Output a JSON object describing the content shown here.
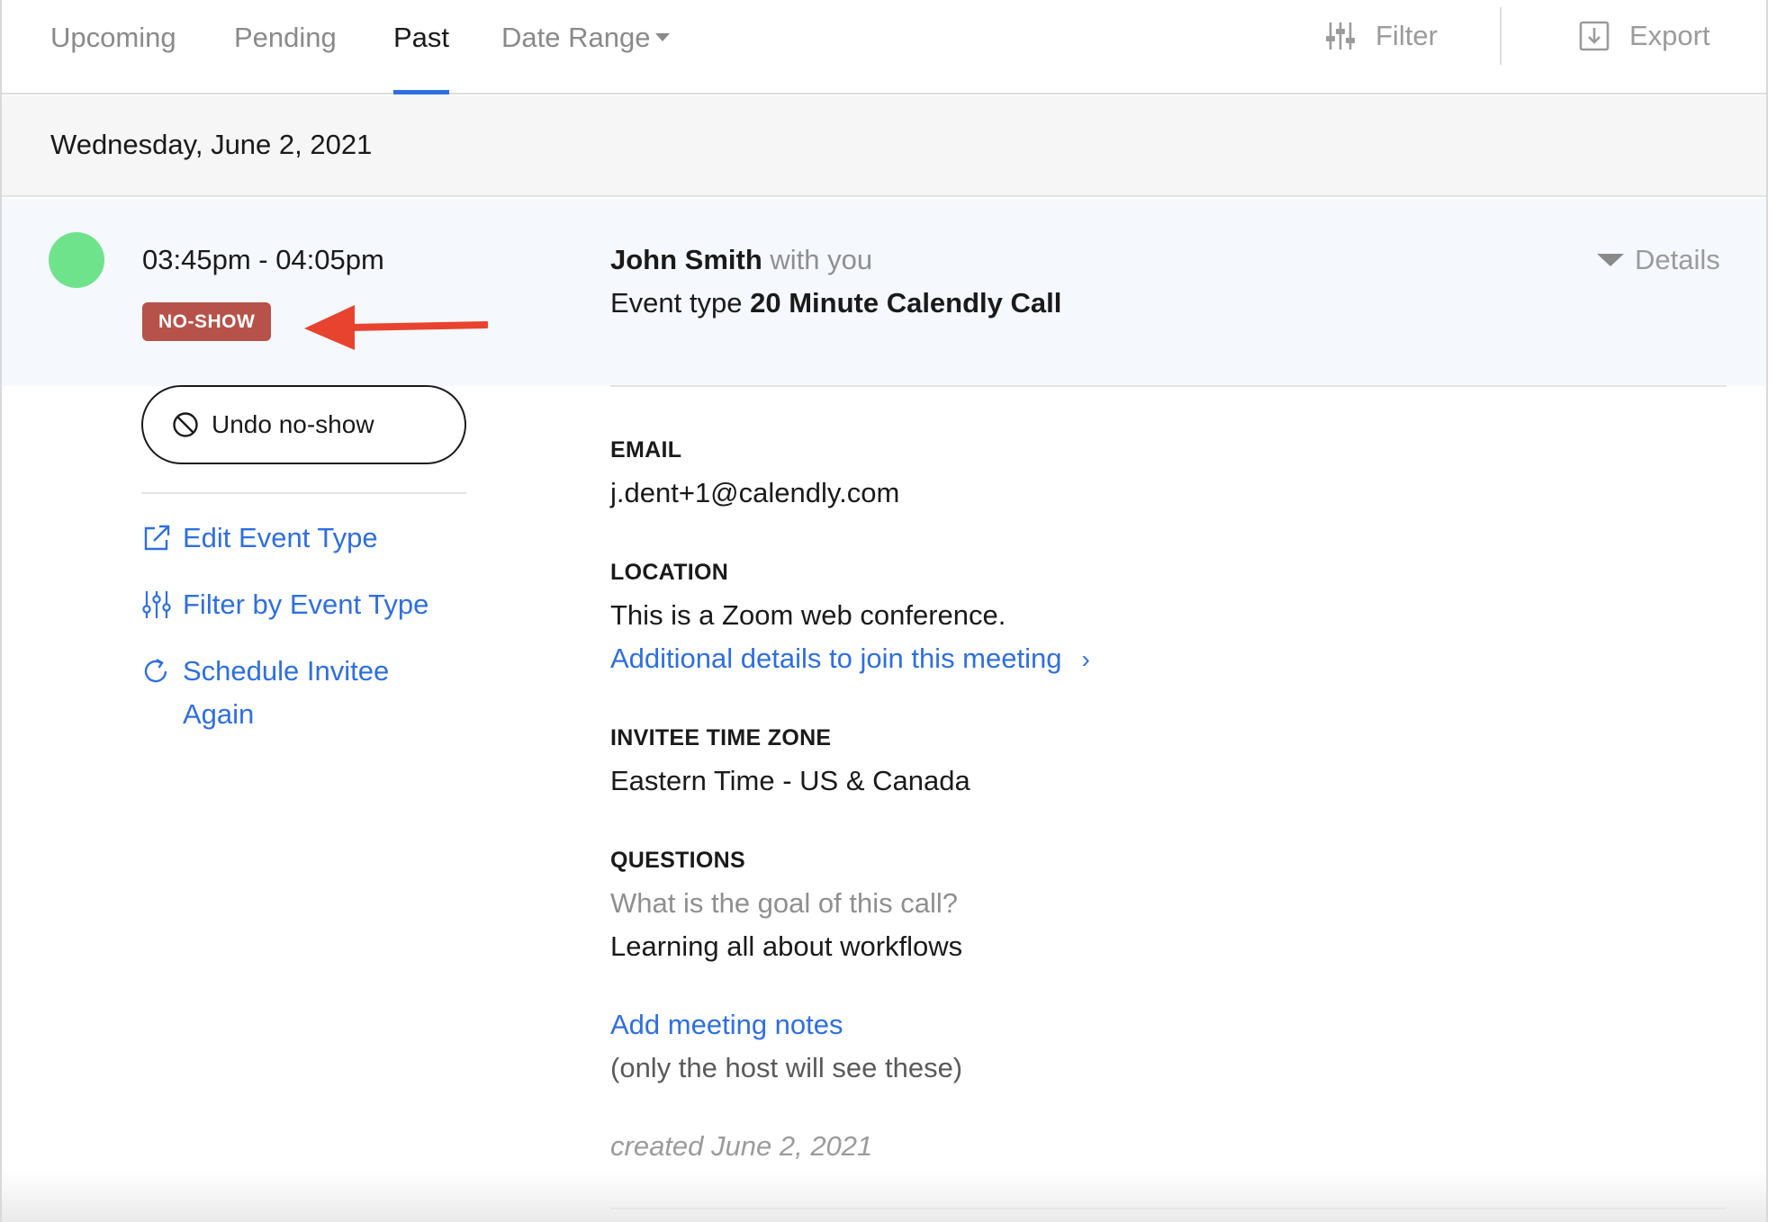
{
  "tabs": {
    "upcoming": "Upcoming",
    "pending": "Pending",
    "past": "Past",
    "date_range": "Date Range"
  },
  "toolbar": {
    "filter": "Filter",
    "export": "Export"
  },
  "date_header": "Wednesday, June 2, 2021",
  "event": {
    "time": "03:45pm - 04:05pm",
    "status_badge": "NO-SHOW",
    "invitee_name": "John Smith",
    "with_text": "with you",
    "event_type_label": "Event type",
    "event_type_name": "20 Minute Calendly Call",
    "details_label": "Details",
    "status_color": "#6fe38c",
    "badge_color": "#b6524a"
  },
  "actions": {
    "undo_no_show": "Undo no-show",
    "edit_event_type": "Edit Event Type",
    "filter_by_event_type": "Filter by Event Type",
    "schedule_invitee_line1": "Schedule Invitee",
    "schedule_invitee_line2": "Again"
  },
  "details": {
    "email_label": "EMAIL",
    "email_value": "j.dent+1@calendly.com",
    "location_label": "LOCATION",
    "location_value": "This is a Zoom web conference.",
    "location_link": "Additional details to join this meeting",
    "timezone_label": "INVITEE TIME ZONE",
    "timezone_value": "Eastern Time - US & Canada",
    "questions_label": "QUESTIONS",
    "question_1": "What is the goal of this call?",
    "answer_1": "Learning all about workflows",
    "notes_link": "Add meeting notes",
    "notes_hint": "(only the host will see these)",
    "created": "created June 2, 2021"
  },
  "colors": {
    "accent": "#2e6fe0",
    "annotation_arrow": "#e8432f"
  }
}
